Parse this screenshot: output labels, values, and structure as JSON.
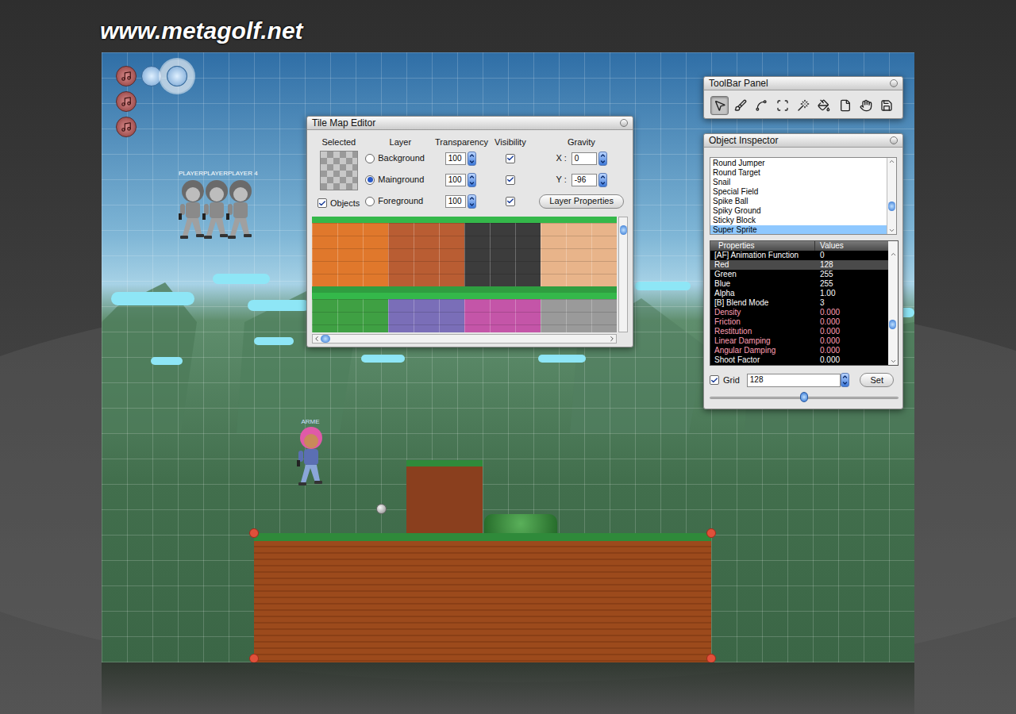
{
  "watermark": "www.metagolf.net",
  "canvas": {
    "player_labels": [
      "PLAYER",
      "PLAYER",
      "PLAYER 4"
    ],
    "character_label": "ARME"
  },
  "tile_map_editor": {
    "title": "Tile Map Editor",
    "headers": [
      "Selected",
      "Layer",
      "Transparency",
      "Visibility",
      "Gravity"
    ],
    "objects_checkbox": {
      "label": "Objects",
      "checked": true
    },
    "layers": [
      {
        "name": "Background",
        "selected": false,
        "transparency": "100",
        "visible": true
      },
      {
        "name": "Mainground",
        "selected": true,
        "transparency": "100",
        "visible": true
      },
      {
        "name": "Foreground",
        "selected": false,
        "transparency": "100",
        "visible": true
      }
    ],
    "gravity": {
      "x_label": "X :",
      "x": "0",
      "y_label": "Y :",
      "y": "-96"
    },
    "layer_properties_button": "Layer Properties",
    "tiles": [
      {
        "color": "#e0782c"
      },
      {
        "color": "#b95d33"
      },
      {
        "color": "#3c3c3c"
      },
      {
        "color": "#e8b48a"
      },
      {
        "color": "#3fa043"
      },
      {
        "color": "#7a6eb8"
      },
      {
        "color": "#c455a8"
      },
      {
        "color": "#9a9a9a"
      }
    ],
    "vertical_scroll": {
      "level": 0
    },
    "horizontal_scroll": {
      "level": 0
    }
  },
  "toolbar": {
    "title": "ToolBar Panel",
    "tools": [
      {
        "selected": true
      },
      {
        "selected": false
      },
      {
        "selected": false
      },
      {
        "selected": false
      },
      {
        "selected": false
      },
      {
        "selected": false
      },
      {
        "selected": false
      },
      {
        "selected": false
      },
      {
        "selected": false
      }
    ]
  },
  "object_inspector": {
    "title": "Object Inspector",
    "objects": [
      {
        "name": "Round Jumper",
        "selected": false
      },
      {
        "name": "Round Target",
        "selected": false
      },
      {
        "name": "Snail",
        "selected": false
      },
      {
        "name": "Special Field",
        "selected": false
      },
      {
        "name": "Spike Ball",
        "selected": false
      },
      {
        "name": "Spiky Ground",
        "selected": false
      },
      {
        "name": "Sticky Block",
        "selected": false
      },
      {
        "name": "Super Sprite",
        "selected": true
      }
    ],
    "objects_scroll": {
      "level": 0.7
    },
    "columns": [
      "Properties",
      "Values"
    ],
    "properties": [
      {
        "name": "[AF] Animation Function",
        "value": "0",
        "selected": false,
        "color": "#ffffff"
      },
      {
        "name": "Red",
        "value": "128",
        "selected": true,
        "color": "#ffffff"
      },
      {
        "name": "Green",
        "value": "255",
        "selected": false,
        "color": "#ffffff"
      },
      {
        "name": "Blue",
        "value": "255",
        "selected": false,
        "color": "#ffffff"
      },
      {
        "name": "Alpha",
        "value": "1.00",
        "selected": false,
        "color": "#ffffff"
      },
      {
        "name": "[B] Blend Mode",
        "value": "3",
        "selected": false,
        "color": "#ffffff"
      },
      {
        "name": "Density",
        "value": "0.000",
        "selected": false,
        "color": "#ff9fb4"
      },
      {
        "name": "Friction",
        "value": "0.000",
        "selected": false,
        "color": "#ff9fb4"
      },
      {
        "name": "Restitution",
        "value": "0.000",
        "selected": false,
        "color": "#ff9fb4"
      },
      {
        "name": "Linear Damping",
        "value": "0.000",
        "selected": false,
        "color": "#ff9fb4"
      },
      {
        "name": "Angular Damping",
        "value": "0.000",
        "selected": false,
        "color": "#ff9fb4"
      },
      {
        "name": "Shoot Factor",
        "value": "0.000",
        "selected": false,
        "color": "#ffffff"
      }
    ],
    "properties_scroll": {
      "level": 0.68
    },
    "grid": {
      "label": "Grid",
      "checked": true,
      "value": "128",
      "button": "Set",
      "slider_level": 0.5
    }
  }
}
